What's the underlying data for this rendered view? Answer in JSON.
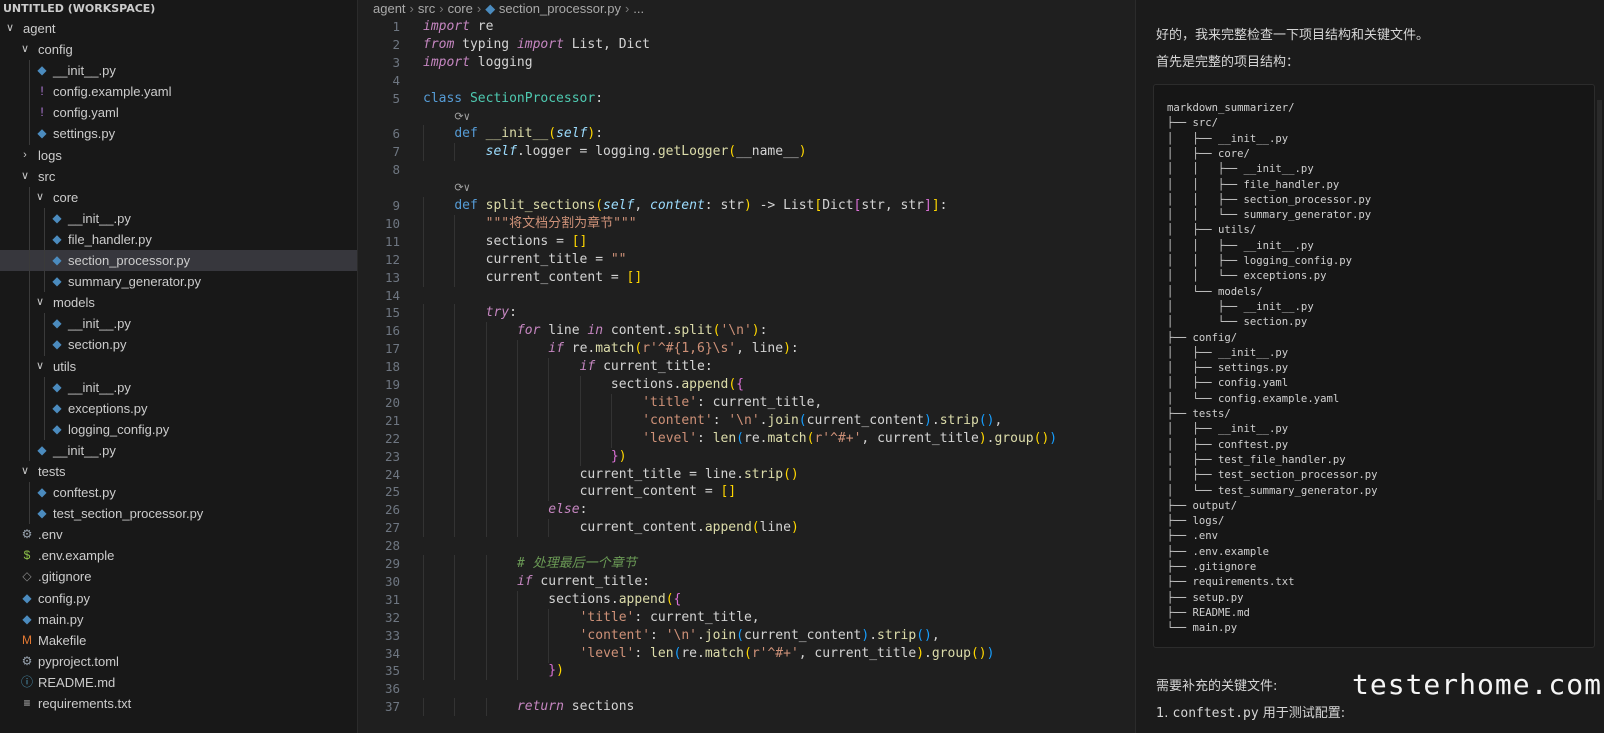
{
  "explorer": {
    "workspace_title": "UNTITLED (WORKSPACE)",
    "items": [
      {
        "label": "agent",
        "kind": "folder",
        "depth": 0,
        "open": true
      },
      {
        "label": "config",
        "kind": "folder",
        "depth": 1,
        "open": true
      },
      {
        "label": "__init__.py",
        "kind": "py",
        "depth": 2
      },
      {
        "label": "config.example.yaml",
        "kind": "yaml",
        "depth": 2
      },
      {
        "label": "config.yaml",
        "kind": "yaml",
        "depth": 2
      },
      {
        "label": "settings.py",
        "kind": "py",
        "depth": 2
      },
      {
        "label": "logs",
        "kind": "folder",
        "depth": 1,
        "open": false
      },
      {
        "label": "src",
        "kind": "folder",
        "depth": 1,
        "open": true
      },
      {
        "label": "core",
        "kind": "folder",
        "depth": 2,
        "open": true
      },
      {
        "label": "__init__.py",
        "kind": "py",
        "depth": 3
      },
      {
        "label": "file_handler.py",
        "kind": "py",
        "depth": 3
      },
      {
        "label": "section_processor.py",
        "kind": "py",
        "depth": 3,
        "selected": true
      },
      {
        "label": "summary_generator.py",
        "kind": "py",
        "depth": 3
      },
      {
        "label": "models",
        "kind": "folder",
        "depth": 2,
        "open": true
      },
      {
        "label": "__init__.py",
        "kind": "py",
        "depth": 3
      },
      {
        "label": "section.py",
        "kind": "py",
        "depth": 3
      },
      {
        "label": "utils",
        "kind": "folder",
        "depth": 2,
        "open": true
      },
      {
        "label": "__init__.py",
        "kind": "py",
        "depth": 3
      },
      {
        "label": "exceptions.py",
        "kind": "py",
        "depth": 3
      },
      {
        "label": "logging_config.py",
        "kind": "py",
        "depth": 3
      },
      {
        "label": "__init__.py",
        "kind": "py",
        "depth": 2
      },
      {
        "label": "tests",
        "kind": "folder",
        "depth": 1,
        "open": true
      },
      {
        "label": "conftest.py",
        "kind": "py",
        "depth": 2
      },
      {
        "label": "test_section_processor.py",
        "kind": "py",
        "depth": 2
      },
      {
        "label": ".env",
        "kind": "gear",
        "depth": 1
      },
      {
        "label": ".env.example",
        "kind": "dollar",
        "depth": 1
      },
      {
        "label": ".gitignore",
        "kind": "git",
        "depth": 1
      },
      {
        "label": "config.py",
        "kind": "py",
        "depth": 1
      },
      {
        "label": "main.py",
        "kind": "py",
        "depth": 1
      },
      {
        "label": "Makefile",
        "kind": "make",
        "depth": 1
      },
      {
        "label": "pyproject.toml",
        "kind": "gear",
        "depth": 1
      },
      {
        "label": "README.md",
        "kind": "info",
        "depth": 1
      },
      {
        "label": "requirements.txt",
        "kind": "txt",
        "depth": 1
      }
    ]
  },
  "breadcrumb": {
    "parts": [
      "agent",
      "src",
      "core"
    ],
    "file": "section_processor.py",
    "tail": "..."
  },
  "editor": {
    "lens_glyph": "⟳∨",
    "lines": [
      {
        "n": "1",
        "i": 0,
        "t": [
          [
            "kw",
            "import"
          ],
          [
            "",
            " re"
          ]
        ]
      },
      {
        "n": "2",
        "i": 0,
        "t": [
          [
            "kw",
            "from"
          ],
          [
            "",
            " typing "
          ],
          [
            "kw",
            "import"
          ],
          [
            "",
            " List, Dict"
          ]
        ]
      },
      {
        "n": "3",
        "i": 0,
        "t": [
          [
            "kw",
            "import"
          ],
          [
            "",
            " logging"
          ]
        ]
      },
      {
        "n": "4",
        "i": 0,
        "t": []
      },
      {
        "n": "5",
        "i": 0,
        "t": [
          [
            "kwb",
            "class"
          ],
          [
            "",
            " "
          ],
          [
            "cls",
            "SectionProcessor"
          ],
          [
            "",
            ":"
          ]
        ]
      },
      {
        "lens": true,
        "i": 1
      },
      {
        "n": "6",
        "i": 1,
        "t": [
          [
            "kwb",
            "def"
          ],
          [
            "",
            " "
          ],
          [
            "fn",
            "__init__"
          ],
          [
            "br1",
            "("
          ],
          [
            "par",
            "self"
          ],
          [
            "br1",
            ")"
          ],
          [
            "",
            ":"
          ]
        ]
      },
      {
        "n": "7",
        "i": 2,
        "t": [
          [
            "par",
            "self"
          ],
          [
            "",
            ".logger = logging."
          ],
          [
            "fn",
            "getLogger"
          ],
          [
            "br1",
            "("
          ],
          [
            "",
            "__name__"
          ],
          [
            "br1",
            ")"
          ]
        ]
      },
      {
        "n": "8",
        "i": 0,
        "t": []
      },
      {
        "lens": true,
        "i": 1
      },
      {
        "n": "9",
        "i": 1,
        "t": [
          [
            "kwb",
            "def"
          ],
          [
            "",
            " "
          ],
          [
            "fn",
            "split_sections"
          ],
          [
            "br1",
            "("
          ],
          [
            "par",
            "self"
          ],
          [
            "",
            ", "
          ],
          [
            "par",
            "content"
          ],
          [
            "",
            ": str"
          ],
          [
            "br1",
            ")"
          ],
          [
            "",
            " -> List"
          ],
          [
            "br1",
            "["
          ],
          [
            "",
            "Dict"
          ],
          [
            "br2",
            "["
          ],
          [
            "",
            "str, str"
          ],
          [
            "br2",
            "]"
          ],
          [
            "br1",
            "]"
          ],
          [
            "",
            ":"
          ]
        ]
      },
      {
        "n": "10",
        "i": 2,
        "t": [
          [
            "str",
            "\"\"\"将文档分割为章节\"\"\""
          ]
        ]
      },
      {
        "n": "11",
        "i": 2,
        "t": [
          [
            "",
            "sections = "
          ],
          [
            "br1",
            "[]"
          ]
        ]
      },
      {
        "n": "12",
        "i": 2,
        "t": [
          [
            "",
            "current_title = "
          ],
          [
            "str",
            "\"\""
          ]
        ]
      },
      {
        "n": "13",
        "i": 2,
        "t": [
          [
            "",
            "current_content = "
          ],
          [
            "br1",
            "[]"
          ]
        ]
      },
      {
        "n": "14",
        "i": 0,
        "t": []
      },
      {
        "n": "15",
        "i": 2,
        "t": [
          [
            "kw",
            "try"
          ],
          [
            "",
            ":"
          ]
        ]
      },
      {
        "n": "16",
        "i": 3,
        "t": [
          [
            "kw",
            "for"
          ],
          [
            "",
            " line "
          ],
          [
            "kw",
            "in"
          ],
          [
            "",
            " content."
          ],
          [
            "fn",
            "split"
          ],
          [
            "br1",
            "("
          ],
          [
            "str",
            "'\\n'"
          ],
          [
            "br1",
            ")"
          ],
          [
            "",
            ":"
          ]
        ]
      },
      {
        "n": "17",
        "i": 4,
        "t": [
          [
            "kw",
            "if"
          ],
          [
            "",
            " re."
          ],
          [
            "fn",
            "match"
          ],
          [
            "br1",
            "("
          ],
          [
            "str",
            "r'^#{1,6}\\s'"
          ],
          [
            "",
            ", line"
          ],
          [
            "br1",
            ")"
          ],
          [
            "",
            ":"
          ]
        ]
      },
      {
        "n": "18",
        "i": 5,
        "t": [
          [
            "kw",
            "if"
          ],
          [
            "",
            " current_title:"
          ]
        ]
      },
      {
        "n": "19",
        "i": 6,
        "t": [
          [
            "",
            "sections."
          ],
          [
            "fn",
            "append"
          ],
          [
            "br1",
            "("
          ],
          [
            "br2",
            "{"
          ]
        ]
      },
      {
        "n": "20",
        "i": 7,
        "t": [
          [
            "str",
            "'title'"
          ],
          [
            "",
            ": current_title,"
          ]
        ]
      },
      {
        "n": "21",
        "i": 7,
        "t": [
          [
            "str",
            "'content'"
          ],
          [
            "",
            ": "
          ],
          [
            "str",
            "'\\n'"
          ],
          [
            "",
            "."
          ],
          [
            "fn",
            "join"
          ],
          [
            "br3",
            "("
          ],
          [
            "",
            "current_content"
          ],
          [
            "br3",
            ")"
          ],
          [
            "",
            "."
          ],
          [
            "fn",
            "strip"
          ],
          [
            "br3",
            "()"
          ],
          [
            "",
            ","
          ]
        ]
      },
      {
        "n": "22",
        "i": 7,
        "t": [
          [
            "str",
            "'level'"
          ],
          [
            "",
            ": "
          ],
          [
            "fn",
            "len"
          ],
          [
            "br3",
            "("
          ],
          [
            "",
            "re."
          ],
          [
            "fn",
            "match"
          ],
          [
            "br1",
            "("
          ],
          [
            "str",
            "r'^#+'"
          ],
          [
            "",
            ", current_title"
          ],
          [
            "br1",
            ")"
          ],
          [
            "",
            "."
          ],
          [
            "fn",
            "group"
          ],
          [
            "br1",
            "()"
          ],
          [
            "br3",
            ")"
          ]
        ]
      },
      {
        "n": "23",
        "i": 6,
        "t": [
          [
            "br2",
            "}"
          ],
          [
            "br1",
            ")"
          ]
        ]
      },
      {
        "n": "24",
        "i": 5,
        "t": [
          [
            "",
            "current_title = line."
          ],
          [
            "fn",
            "strip"
          ],
          [
            "br1",
            "()"
          ]
        ]
      },
      {
        "n": "25",
        "i": 5,
        "t": [
          [
            "",
            "current_content = "
          ],
          [
            "br1",
            "[]"
          ]
        ]
      },
      {
        "n": "26",
        "i": 4,
        "t": [
          [
            "kw",
            "else"
          ],
          [
            "",
            ":"
          ]
        ]
      },
      {
        "n": "27",
        "i": 5,
        "t": [
          [
            "",
            "current_content."
          ],
          [
            "fn",
            "append"
          ],
          [
            "br1",
            "("
          ],
          [
            "",
            "line"
          ],
          [
            "br1",
            ")"
          ]
        ]
      },
      {
        "n": "28",
        "i": 0,
        "t": []
      },
      {
        "n": "29",
        "i": 3,
        "t": [
          [
            "cmt",
            "# 处理最后一个章节"
          ]
        ]
      },
      {
        "n": "30",
        "i": 3,
        "t": [
          [
            "kw",
            "if"
          ],
          [
            "",
            " current_title:"
          ]
        ]
      },
      {
        "n": "31",
        "i": 4,
        "t": [
          [
            "",
            "sections."
          ],
          [
            "fn",
            "append"
          ],
          [
            "br1",
            "("
          ],
          [
            "br2",
            "{"
          ]
        ]
      },
      {
        "n": "32",
        "i": 5,
        "t": [
          [
            "str",
            "'title'"
          ],
          [
            "",
            ": current_title,"
          ]
        ]
      },
      {
        "n": "33",
        "i": 5,
        "t": [
          [
            "str",
            "'content'"
          ],
          [
            "",
            ": "
          ],
          [
            "str",
            "'\\n'"
          ],
          [
            "",
            "."
          ],
          [
            "fn",
            "join"
          ],
          [
            "br3",
            "("
          ],
          [
            "",
            "current_content"
          ],
          [
            "br3",
            ")"
          ],
          [
            "",
            "."
          ],
          [
            "fn",
            "strip"
          ],
          [
            "br3",
            "()"
          ],
          [
            "",
            ","
          ]
        ]
      },
      {
        "n": "34",
        "i": 5,
        "t": [
          [
            "str",
            "'level'"
          ],
          [
            "",
            ": "
          ],
          [
            "fn",
            "len"
          ],
          [
            "br3",
            "("
          ],
          [
            "",
            "re."
          ],
          [
            "fn",
            "match"
          ],
          [
            "br1",
            "("
          ],
          [
            "str",
            "r'^#+'"
          ],
          [
            "",
            ", current_title"
          ],
          [
            "br1",
            ")"
          ],
          [
            "",
            "."
          ],
          [
            "fn",
            "group"
          ],
          [
            "br1",
            "()"
          ],
          [
            "br3",
            ")"
          ]
        ]
      },
      {
        "n": "35",
        "i": 4,
        "t": [
          [
            "br2",
            "}"
          ],
          [
            "br1",
            ")"
          ]
        ]
      },
      {
        "n": "36",
        "i": 0,
        "t": []
      },
      {
        "n": "37",
        "i": 3,
        "t": [
          [
            "kw",
            "return"
          ],
          [
            "",
            " sections"
          ]
        ]
      }
    ]
  },
  "chat": {
    "intro": "好的，我来完整检查一下项目结构和关键文件。",
    "structure_heading": "首先是完整的项目结构：",
    "tree": [
      "markdown_summarizer/",
      "├── src/",
      "│   ├── __init__.py",
      "│   ├── core/",
      "│   │   ├── __init__.py",
      "│   │   ├── file_handler.py",
      "│   │   ├── section_processor.py",
      "│   │   └── summary_generator.py",
      "│   ├── utils/",
      "│   │   ├── __init__.py",
      "│   │   ├── logging_config.py",
      "│   │   └── exceptions.py",
      "│   └── models/",
      "│       ├── __init__.py",
      "│       └── section.py",
      "├── config/",
      "│   ├── __init__.py",
      "│   ├── settings.py",
      "│   ├── config.yaml",
      "│   └── config.example.yaml",
      "├── tests/",
      "│   ├── __init__.py",
      "│   ├── conftest.py",
      "│   ├── test_file_handler.py",
      "│   ├── test_section_processor.py",
      "│   └── test_summary_generator.py",
      "├── output/",
      "├── logs/",
      "├── .env",
      "├── .env.example",
      "├── .gitignore",
      "├── requirements.txt",
      "├── setup.py",
      "├── README.md",
      "└── main.py"
    ],
    "files_heading": "需要补充的关键文件:",
    "item1_num": "1.",
    "item1_code": "conftest.py",
    "item1_text": "用于测试配置:",
    "watermark": "testerhome.com"
  },
  "colors": {
    "py_icon": "#4b8bbe",
    "yaml_icon": "#b07ad8",
    "selected_row": "#37373d",
    "editor_bg": "#1f1f1f"
  }
}
